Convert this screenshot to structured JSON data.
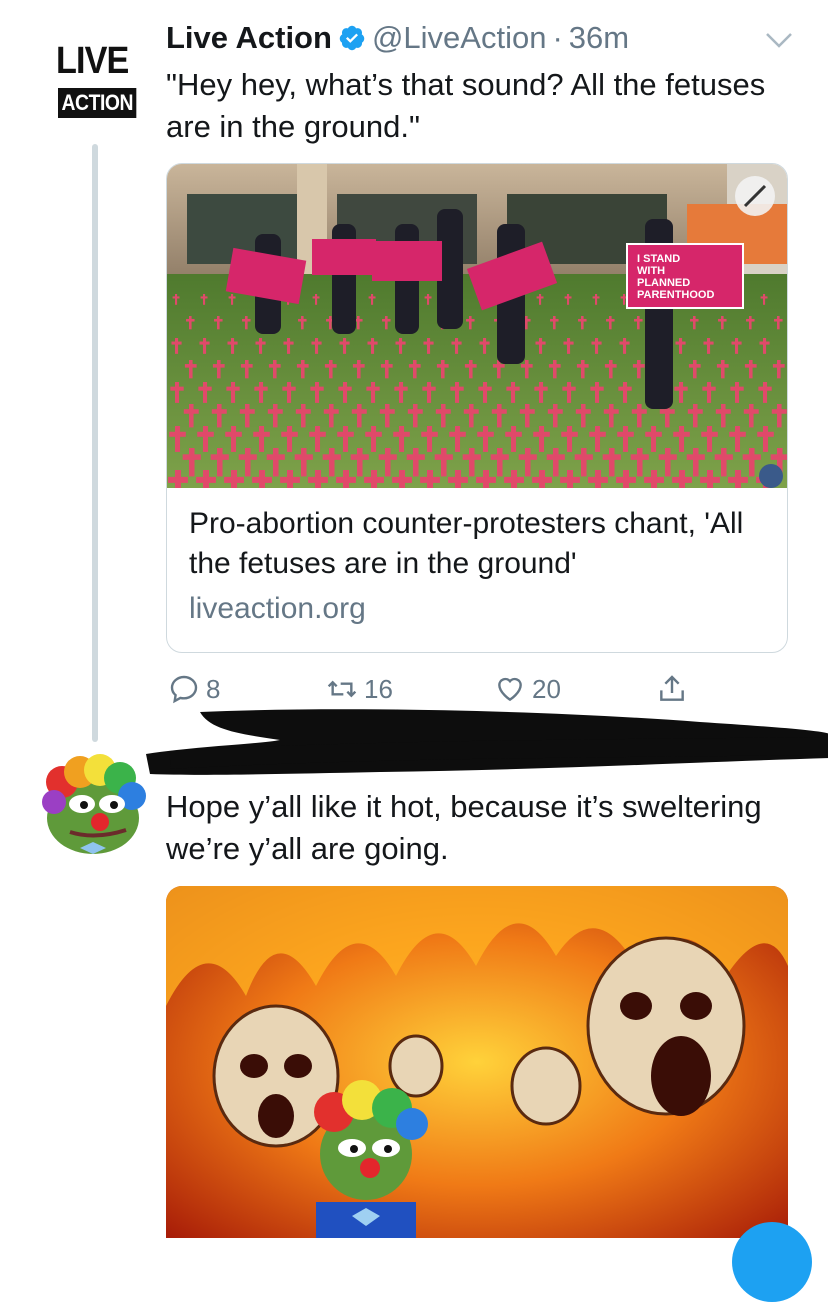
{
  "tweet1": {
    "avatar": {
      "line1": "LIVE",
      "line2": "ACTION"
    },
    "name": "Live Action",
    "handle": "@LiveAction",
    "separator": "·",
    "time": "36m",
    "text": "\"Hey hey, what’s that sound? All the fetuses are in the ground.\"",
    "card": {
      "title": "Pro-abortion counter-protesters chant, 'All the fetuses are in the ground'",
      "domain": "liveaction.org",
      "sign_text": "I STAND WITH PLANNED PARENTHOOD"
    },
    "actions": {
      "replies": "8",
      "retweets": "16",
      "likes": "20"
    }
  },
  "tweet2": {
    "text": "Hope y’all like it hot, because it’s sweltering we’re y’all are going."
  },
  "colors": {
    "text": "#14171a",
    "muted": "#657786",
    "verified": "#1da1f2",
    "border": "#cfd9de",
    "accent": "#1da1f2"
  }
}
